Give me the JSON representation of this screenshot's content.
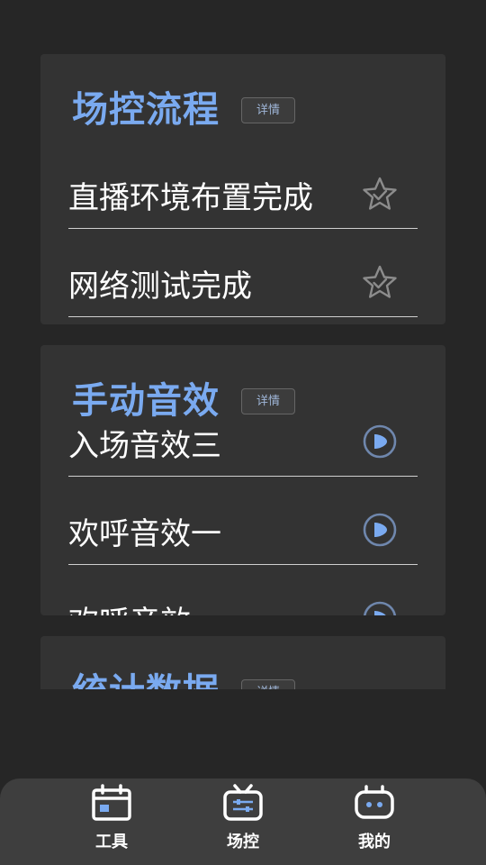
{
  "cards": [
    {
      "title": "场控流程",
      "detail_label": "详情",
      "items": [
        {
          "label": "直播环境布置完成",
          "icon": "star-check-icon"
        },
        {
          "label": "网络测试完成",
          "icon": "star-check-icon"
        }
      ]
    },
    {
      "title": "手动音效",
      "detail_label": "详情",
      "items": [
        {
          "label": "入场音效三",
          "icon": "play-icon"
        },
        {
          "label": "欢呼音效一",
          "icon": "play-icon"
        },
        {
          "label": "欢呼音效",
          "icon": "play-icon"
        }
      ]
    },
    {
      "title": "统计数据",
      "detail_label": "详情"
    }
  ],
  "tabbar": {
    "tabs": [
      {
        "label": "工具",
        "icon": "calendar-icon"
      },
      {
        "label": "场控",
        "icon": "tv-control-icon"
      },
      {
        "label": "我的",
        "icon": "robot-face-icon"
      }
    ]
  },
  "colors": {
    "background": "#262626",
    "card": "#333333",
    "accent": "#7aaaf0",
    "tabbar": "#3e3e3e"
  }
}
